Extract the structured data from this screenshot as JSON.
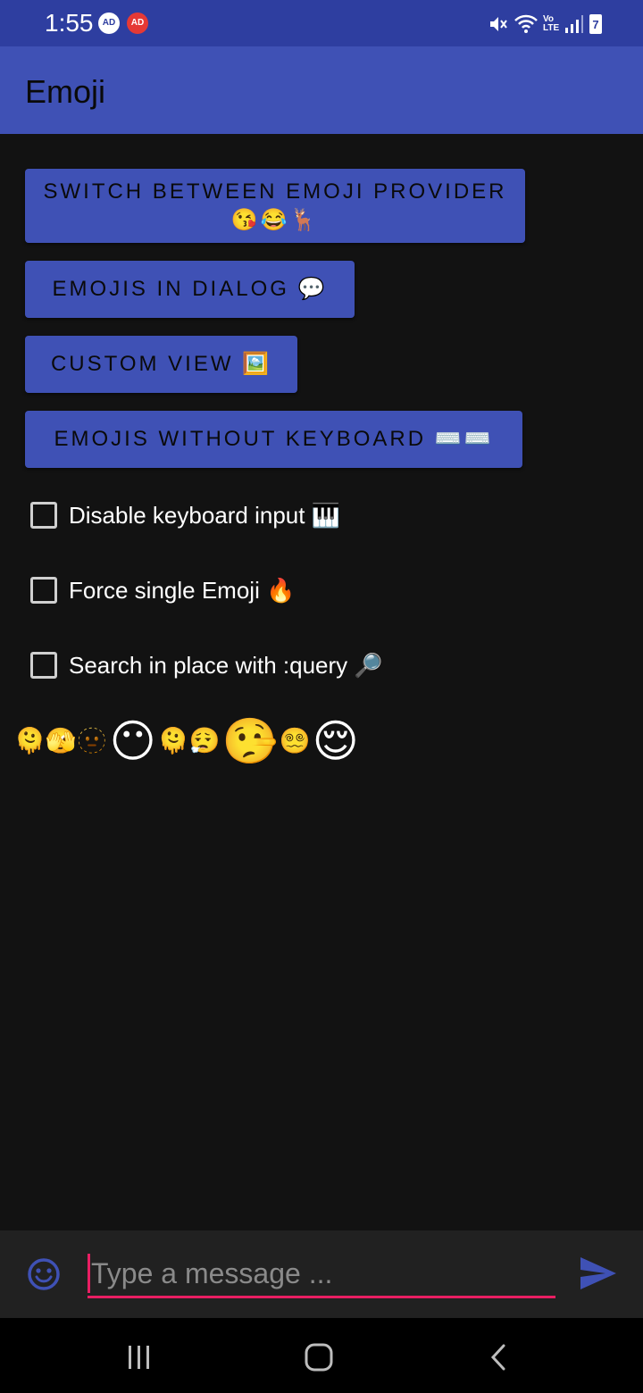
{
  "status_bar": {
    "time": "1:55",
    "badge_1": "AD",
    "badge_2": "AD",
    "network_label": "Vo LTE",
    "battery_level": "7"
  },
  "app_bar": {
    "title": "Emoji"
  },
  "buttons": {
    "switch_provider": "SWITCH BETWEEN EMOJI PROVIDER 😘😂🦌",
    "emojis_in_dialog": "EMOJIS IN DIALOG 💬",
    "custom_view": "CUSTOM VIEW 🖼️",
    "emojis_without_keyboard": "EMOJIS WITHOUT KEYBOARD ⌨️⌨️"
  },
  "checkboxes": [
    {
      "label": "Disable keyboard input 🎹",
      "checked": false
    },
    {
      "label": "Force single Emoji 🔥",
      "checked": false
    },
    {
      "label": "Search in place with :query 🔎",
      "checked": false
    }
  ],
  "emoji_strip": {
    "small_1": "🫠🫣🫥",
    "big_1": "😶",
    "small_2": "🫠😮‍💨",
    "big_2": "🤥",
    "small_3": "😵‍💫",
    "big_3": "😌"
  },
  "message_input": {
    "placeholder": "Type a message ...",
    "value": ""
  },
  "colors": {
    "primary": "#3f51b5",
    "status_bar": "#2e3ea0",
    "accent": "#e91e63",
    "background": "#121212"
  },
  "icons": {
    "emoji_toggle": "emoji-smile-icon",
    "send": "send-icon",
    "nav_recent": "recent-apps-icon",
    "nav_home": "home-icon",
    "nav_back": "back-icon"
  }
}
